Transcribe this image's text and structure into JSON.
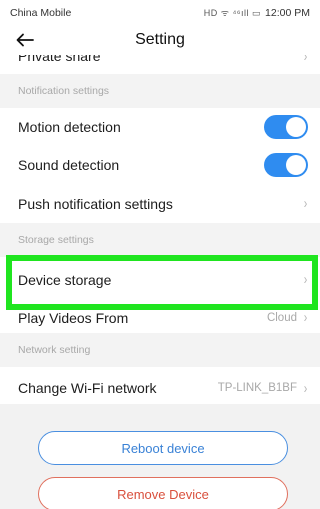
{
  "status_bar": {
    "carrier": "China Mobile",
    "icons": "HD ᯤ ⁴⁶ıll ▭",
    "time": "12:00 PM"
  },
  "header": {
    "title": "Setting"
  },
  "partial_row": {
    "label": "Private share"
  },
  "sections": {
    "notification": "Notification settings",
    "storage": "Storage settings",
    "network": "Network setting"
  },
  "rows": {
    "motion_detection": {
      "label": "Motion detection",
      "enabled": true
    },
    "sound_detection": {
      "label": "Sound detection",
      "enabled": true
    },
    "push_notification": {
      "label": "Push notification settings"
    },
    "device_storage": {
      "label": "Device storage"
    },
    "play_videos": {
      "label": "Play Videos From",
      "value": "Cloud"
    },
    "wifi": {
      "label": "Change Wi-Fi network",
      "value": "TP-LINK_B1BF"
    }
  },
  "buttons": {
    "reboot": "Reboot device",
    "remove": "Remove Device"
  },
  "colors": {
    "toggle_on": "#2f8cf0",
    "highlight": "#1fe51f",
    "reboot": "#3a82d6",
    "remove": "#d9503d"
  }
}
